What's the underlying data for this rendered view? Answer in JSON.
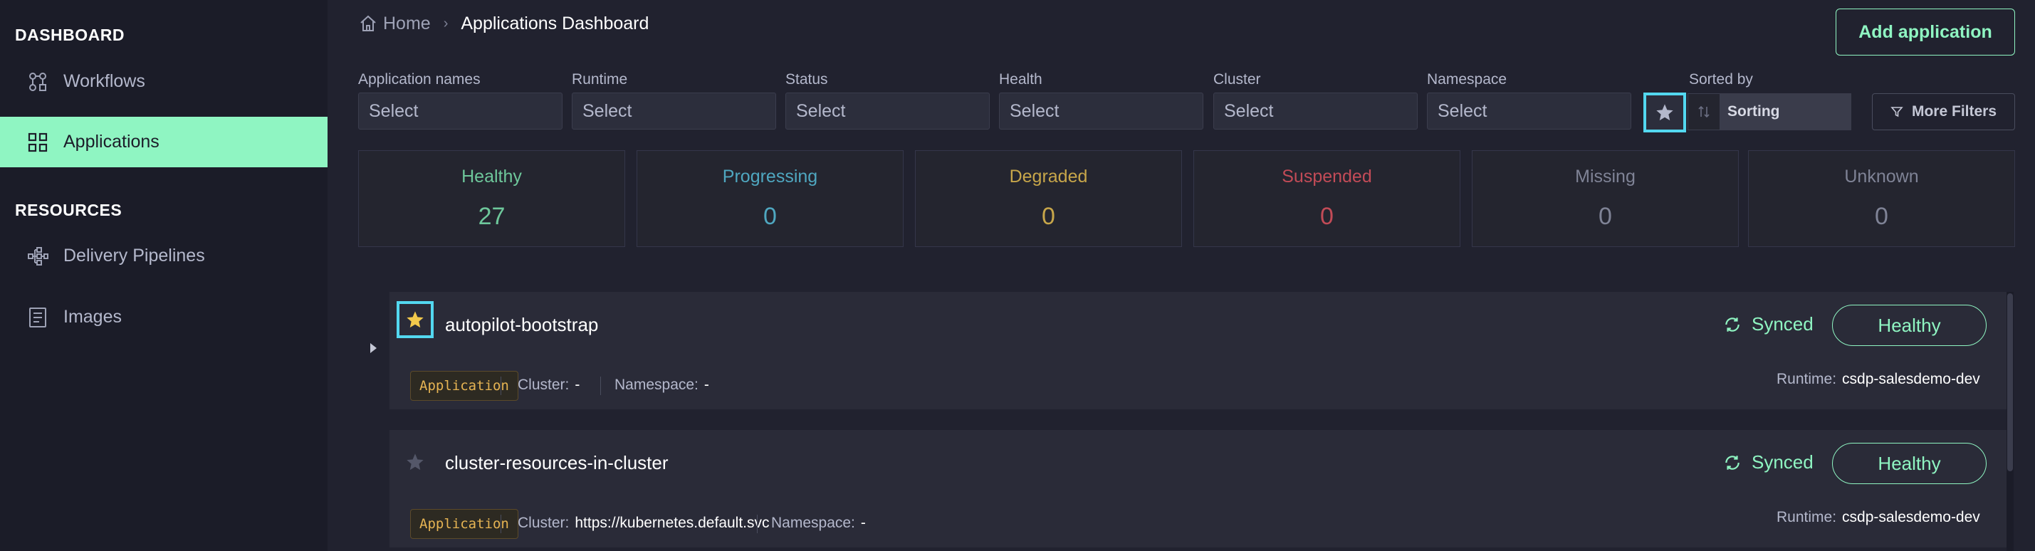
{
  "sidebar": {
    "dashboard_title": "DASHBOARD",
    "resources_title": "RESOURCES",
    "items": [
      {
        "label": "Workflows",
        "icon": "workflows-icon"
      },
      {
        "label": "Applications",
        "icon": "grid-icon",
        "active": true
      },
      {
        "label": "Delivery Pipelines",
        "icon": "pipelines-icon"
      },
      {
        "label": "Images",
        "icon": "images-icon"
      }
    ]
  },
  "breadcrumb": {
    "home": "Home",
    "current": "Applications Dashboard"
  },
  "header": {
    "add_button": "Add application"
  },
  "filters": [
    {
      "label": "Application names",
      "placeholder": "Select"
    },
    {
      "label": "Runtime",
      "placeholder": "Select"
    },
    {
      "label": "Status",
      "placeholder": "Select"
    },
    {
      "label": "Health",
      "placeholder": "Select"
    },
    {
      "label": "Cluster",
      "placeholder": "Select"
    },
    {
      "label": "Namespace",
      "placeholder": "Select"
    }
  ],
  "sort": {
    "label": "Sorted by",
    "value": "Sorting"
  },
  "more_filters": "More Filters",
  "stats": [
    {
      "name": "Healthy",
      "count": "27",
      "color": "#6ec79b"
    },
    {
      "name": "Progressing",
      "count": "0",
      "color": "#4fa7c0"
    },
    {
      "name": "Degraded",
      "count": "0",
      "color": "#c7a64a"
    },
    {
      "name": "Suspended",
      "count": "0",
      "color": "#c24b57"
    },
    {
      "name": "Missing",
      "count": "0",
      "color": "#7f8396"
    },
    {
      "name": "Unknown",
      "count": "0",
      "color": "#7f8396"
    }
  ],
  "apps": [
    {
      "name": "autopilot-bootstrap",
      "favorite": true,
      "sync": "Synced",
      "health": "Healthy",
      "tag": "Application",
      "cluster_label": "Cluster:",
      "cluster": "-",
      "namespace_label": "Namespace:",
      "namespace": "-",
      "runtime_label": "Runtime:",
      "runtime": "csdp-salesdemo-dev"
    },
    {
      "name": "cluster-resources-in-cluster",
      "favorite": false,
      "sync": "Synced",
      "health": "Healthy",
      "tag": "Application",
      "cluster_label": "Cluster:",
      "cluster": "https://kubernetes.default.svc",
      "namespace_label": "Namespace:",
      "namespace": "-",
      "runtime_label": "Runtime:",
      "runtime": "csdp-salesdemo-dev"
    }
  ]
}
